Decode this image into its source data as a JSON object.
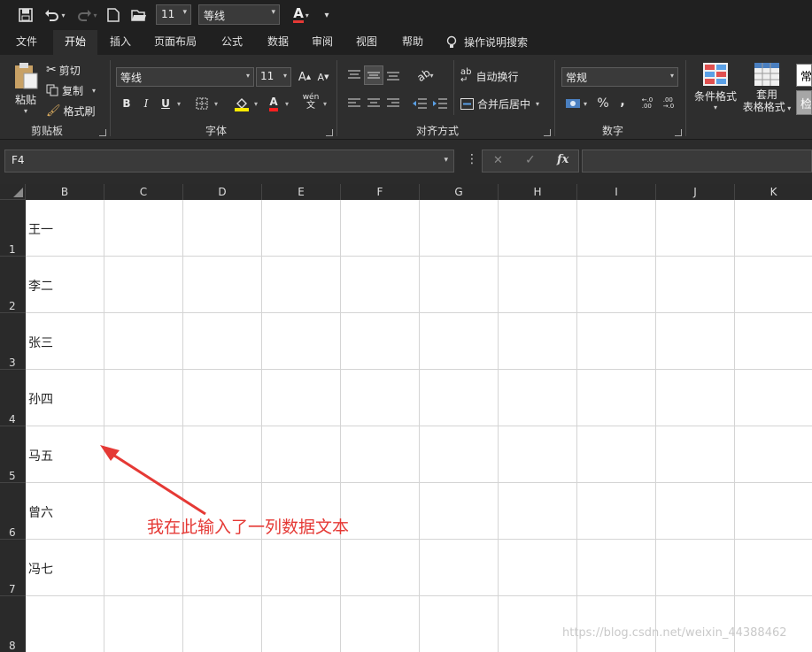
{
  "qat": {
    "font_size": "11",
    "font_name": "等线"
  },
  "tabs": [
    "文件",
    "开始",
    "插入",
    "页面布局",
    "公式",
    "数据",
    "审阅",
    "视图",
    "帮助",
    "操作说明搜索"
  ],
  "ribbon": {
    "clipboard": {
      "paste": "粘贴",
      "cut": "剪切",
      "copy": "复制",
      "format_painter": "格式刷",
      "label": "剪贴板"
    },
    "font": {
      "name": "等线",
      "size": "11",
      "grow": "A",
      "shrink": "A",
      "bold": "B",
      "italic": "I",
      "underline": "U",
      "font_color": "A",
      "phonetic": "wén",
      "label": "字体"
    },
    "alignment": {
      "wrap": "自动换行",
      "merge": "合并后居中",
      "label": "对齐方式"
    },
    "number": {
      "format": "常规",
      "percent": "%",
      "comma": ",",
      "label": "数字"
    },
    "styles": {
      "conditional": "条件格式",
      "table_line1": "套用",
      "table_line2": "表格格式",
      "cell_style_partial": "常",
      "cell_style2_partial": "检"
    }
  },
  "formula_bar": {
    "name_box": "F4",
    "cancel": "✕",
    "enter": "✓",
    "fx": "fx",
    "value": ""
  },
  "columns": [
    "B",
    "C",
    "D",
    "E",
    "F",
    "G",
    "H",
    "I",
    "J",
    "K"
  ],
  "rows": [
    "1",
    "2",
    "3",
    "4",
    "5",
    "6",
    "7",
    "8"
  ],
  "cells_B": [
    "王一",
    "李二",
    "张三",
    "孙四",
    "马五",
    "曾六",
    "冯七",
    ""
  ],
  "annotation": "我在此输入了一列数据文本",
  "watermark": "https://blog.csdn.net/weixin_44388462",
  "colors": {
    "annotation_red": "#e53935",
    "ribbon_bg": "#2e2e2e",
    "grid_line": "#d4d4d4"
  }
}
